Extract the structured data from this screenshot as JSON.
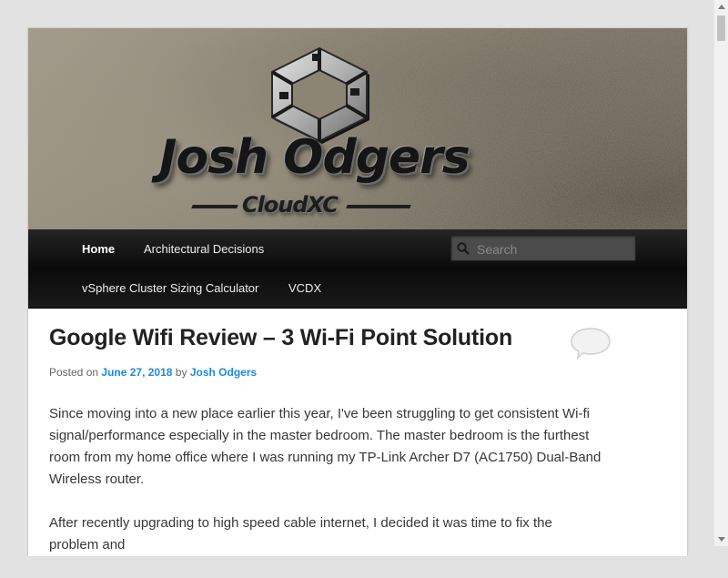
{
  "header": {
    "logo_title": "Josh Odgers",
    "logo_subtitle": "CloudXC"
  },
  "nav": {
    "items": [
      {
        "label": "Home",
        "active": true
      },
      {
        "label": "Architectural Decisions",
        "active": false
      },
      {
        "label": "vSphere Cluster Sizing Calculator",
        "active": false
      },
      {
        "label": "VCDX",
        "active": false
      }
    ],
    "search_placeholder": "Search"
  },
  "post": {
    "title": "Google Wifi Review – 3 Wi-Fi Point Solution",
    "meta_posted_on": "Posted on",
    "date": "June 27, 2018",
    "meta_by": "by",
    "author": "Josh Odgers",
    "paragraph_1": "Since moving into a new place earlier this year, I've been struggling to get consistent Wi-fi signal/performance especially in the master bedroom. The master bedroom is the furthest room from my home office where I was running my TP-Link Archer D7 (AC1750) Dual-Band Wireless router.",
    "paragraph_2": "After recently upgrading to high speed cable internet, I decided it was time to fix the problem and"
  },
  "colors": {
    "link": "#1b8be0",
    "nav_bg": "#0a0a0a",
    "page_bg": "#e2e2e2"
  },
  "icons": {
    "search": "magnifier-icon",
    "comments": "speech-bubble-icon",
    "scroll_up": "arrow-up-icon",
    "scroll_down": "arrow-down-icon"
  }
}
